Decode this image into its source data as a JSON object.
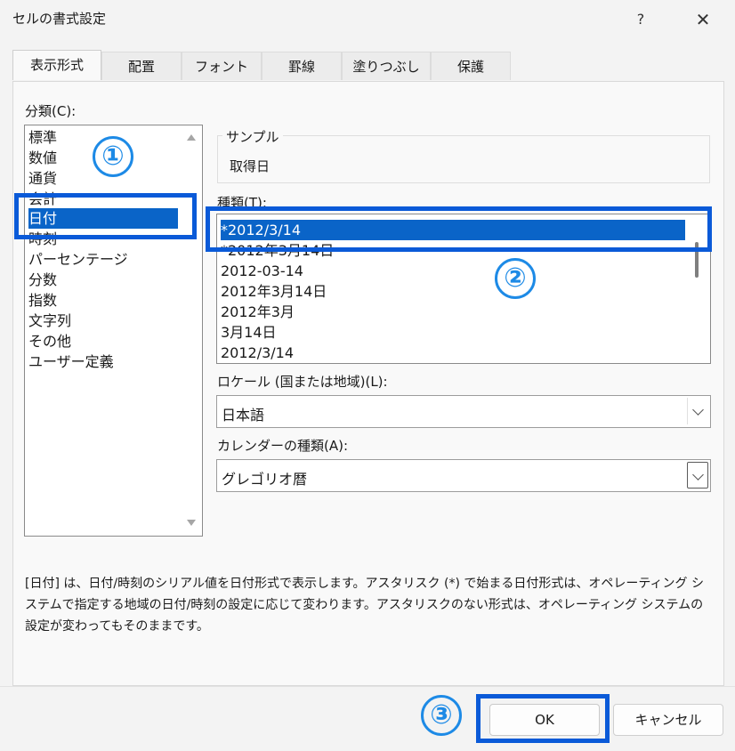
{
  "window": {
    "title": "セルの書式設定",
    "help": "?",
    "close": "✕"
  },
  "tabs": [
    "表示形式",
    "配置",
    "フォント",
    "罫線",
    "塗りつぶし",
    "保護"
  ],
  "category": {
    "label": "分類(C):",
    "items": [
      "標準",
      "数値",
      "通貨",
      "会計",
      "日付",
      "時刻",
      "パーセンテージ",
      "分数",
      "指数",
      "文字列",
      "その他",
      "ユーザー定義"
    ],
    "selected": "日付"
  },
  "sample": {
    "label": "サンプル",
    "value": "取得日"
  },
  "format_type": {
    "label": "種類(T):",
    "items": [
      "*2012/3/14",
      "*2012年3月14日",
      "2012-03-14",
      "2012年3月14日",
      "2012年3月",
      "3月14日",
      "2012/3/14"
    ],
    "selected": "*2012/3/14"
  },
  "locale": {
    "label": "ロケール (国または地域)(L):",
    "value": "日本語"
  },
  "calendar": {
    "label": "カレンダーの種類(A):",
    "value": "グレゴリオ暦"
  },
  "description": "[日付] は、日付/時刻のシリアル値を日付形式で表示します。アスタリスク (*) で始まる日付形式は、オペレーティング システムで指定する地域の日付/時刻の設定に応じて変わります。アスタリスクのない形式は、オペレーティング システムの設定が変わってもそのままです。",
  "buttons": {
    "ok": "OK",
    "cancel": "キャンセル"
  },
  "annotations": {
    "step1": "①",
    "step2": "②",
    "step3": "③"
  },
  "colors": {
    "highlight": "#0a5ad8",
    "selection": "#0a64c8",
    "marker": "#1d8ae6"
  }
}
